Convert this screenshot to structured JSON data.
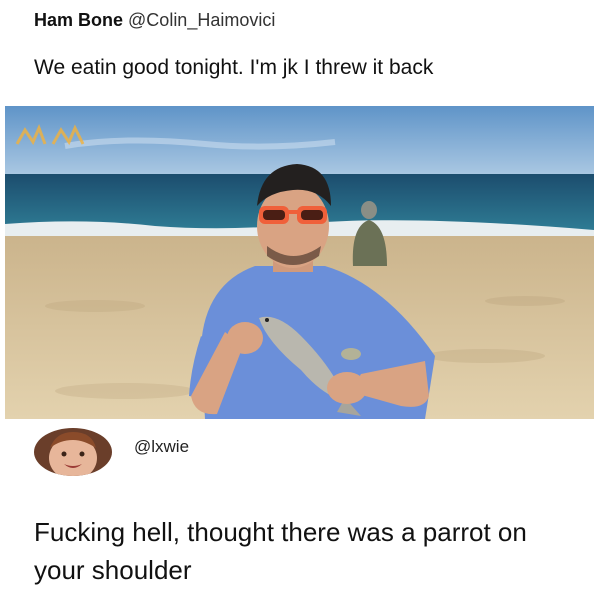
{
  "tweet": {
    "display_name": "Ham Bone",
    "handle": "@Colin_Haimovici",
    "text": "We eatin good tonight. I'm jk I threw it back"
  },
  "photo": {
    "description_icon": "beach-photo",
    "colors": {
      "sky": "#6fa2cf",
      "sea": "#1f5f7e",
      "sand": "#d8c49e",
      "shirt": "#6b8fd9",
      "sunglasses": "#f0603a"
    }
  },
  "reply": {
    "handle": "@lxwie",
    "text": "Fucking hell, thought there was a parrot on your shoulder"
  }
}
